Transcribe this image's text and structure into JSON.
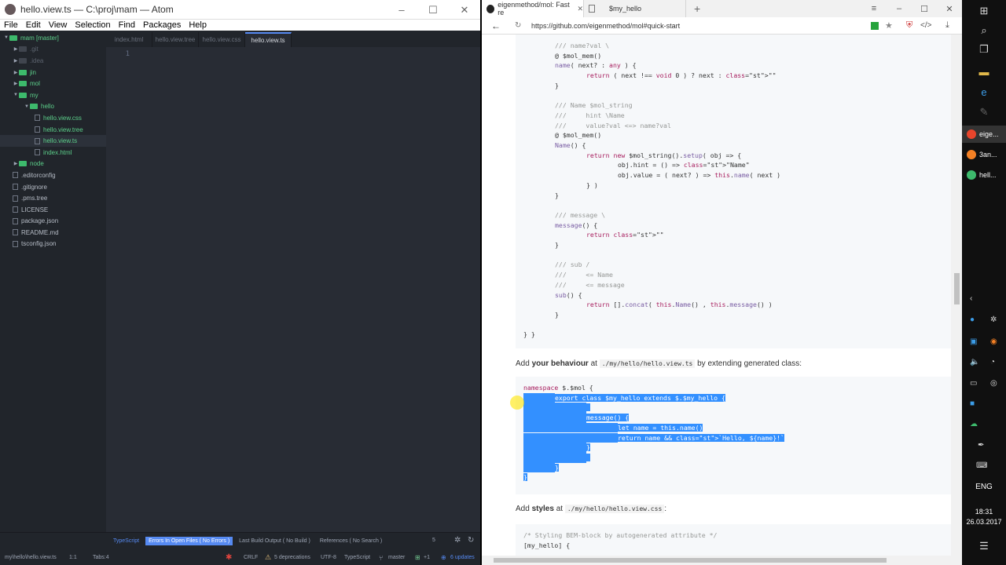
{
  "atom": {
    "title": "hello.view.ts — C:\\proj\\mam — Atom",
    "menu": [
      "File",
      "Edit",
      "View",
      "Selection",
      "Find",
      "Packages",
      "Help"
    ],
    "tree": [
      {
        "label": "mam [master]",
        "kind": "root"
      },
      {
        "label": ".git",
        "kind": "folder",
        "dim": true
      },
      {
        "label": ".idea",
        "kind": "folder",
        "dim": true
      },
      {
        "label": "jin",
        "kind": "folder"
      },
      {
        "label": "mol",
        "kind": "folder"
      },
      {
        "label": "my",
        "kind": "folder",
        "open": true
      },
      {
        "label": "hello",
        "kind": "folder",
        "open": true,
        "depth": 1
      },
      {
        "label": "hello.view.css",
        "kind": "file",
        "depth": 2
      },
      {
        "label": "hello.view.tree",
        "kind": "file",
        "depth": 2
      },
      {
        "label": "hello.view.ts",
        "kind": "file",
        "depth": 2,
        "selected": true
      },
      {
        "label": "index.html",
        "kind": "file",
        "depth": 2
      },
      {
        "label": "node",
        "kind": "folder"
      },
      {
        "label": ".editorconfig",
        "kind": "file"
      },
      {
        "label": ".gitignore",
        "kind": "file"
      },
      {
        "label": ".pms.tree",
        "kind": "file"
      },
      {
        "label": "LICENSE",
        "kind": "file"
      },
      {
        "label": "package.json",
        "kind": "file"
      },
      {
        "label": "README.md",
        "kind": "file"
      },
      {
        "label": "tsconfig.json",
        "kind": "file"
      }
    ],
    "tabs": [
      "index.html",
      "hello.view.tree",
      "hello.view.css",
      "hello.view.ts"
    ],
    "active_tab": 3,
    "line_number": "1",
    "ts_bar": {
      "typescript": "TypeScript",
      "errors": "Errors In Open Files ( No Errors )",
      "build": "Last Build Output ( No Build )",
      "refs": "References ( No Search )",
      "count": "5"
    },
    "status": {
      "path": "my\\hello\\hello.view.ts",
      "pos": "1:1",
      "tabs": "Tabs:4",
      "eol": "CRLF",
      "deprecations": "5 deprecations",
      "enc": "UTF-8",
      "grammar": "TypeScript",
      "branch": "master",
      "diff": "+1",
      "updates": "6 updates"
    }
  },
  "browser": {
    "tabs": [
      {
        "title": "eigenmethod/mol: Fast re"
      },
      {
        "title": "$my_hello"
      }
    ],
    "url": "https://github.com/eigenmethod/mol#quick-start",
    "code1": [
      {
        "t": "/// name?val \\",
        "c": "cm",
        "i": 1
      },
      {
        "t": "@ $mol_mem()",
        "c": "",
        "i": 1
      },
      {
        "t": "name( next? : any ) {",
        "c": "",
        "i": 1
      },
      {
        "t": "return ( next !== void 0 ) ? next : \"\"",
        "c": "",
        "i": 2
      },
      {
        "t": "}",
        "c": "",
        "i": 1
      },
      {
        "t": "",
        "c": "",
        "i": 0
      },
      {
        "t": "/// Name $mol_string",
        "c": "cm",
        "i": 1
      },
      {
        "t": "///     hint \\Name",
        "c": "cm",
        "i": 1
      },
      {
        "t": "///     value?val <=> name?val",
        "c": "cm",
        "i": 1
      },
      {
        "t": "@ $mol_mem()",
        "c": "",
        "i": 1
      },
      {
        "t": "Name() {",
        "c": "",
        "i": 1
      },
      {
        "t": "return new $mol_string().setup( obj => {",
        "c": "",
        "i": 2
      },
      {
        "t": "obj.hint = () => \"Name\"",
        "c": "",
        "i": 3
      },
      {
        "t": "obj.value = ( next? ) => this.name( next )",
        "c": "",
        "i": 3
      },
      {
        "t": "} )",
        "c": "",
        "i": 2
      },
      {
        "t": "}",
        "c": "",
        "i": 1
      },
      {
        "t": "",
        "c": "",
        "i": 0
      },
      {
        "t": "/// message \\",
        "c": "cm",
        "i": 1
      },
      {
        "t": "message() {",
        "c": "",
        "i": 1
      },
      {
        "t": "return \"\"",
        "c": "",
        "i": 2
      },
      {
        "t": "}",
        "c": "",
        "i": 1
      },
      {
        "t": "",
        "c": "",
        "i": 0
      },
      {
        "t": "/// sub /",
        "c": "cm",
        "i": 1
      },
      {
        "t": "///     <= Name",
        "c": "cm",
        "i": 1
      },
      {
        "t": "///     <= message",
        "c": "cm",
        "i": 1
      },
      {
        "t": "sub() {",
        "c": "",
        "i": 1
      },
      {
        "t": "return [].concat( this.Name() , this.message() )",
        "c": "",
        "i": 2
      },
      {
        "t": "}",
        "c": "",
        "i": 1
      },
      {
        "t": "",
        "c": "",
        "i": 0
      },
      {
        "t": "} }",
        "c": "",
        "i": 0
      }
    ],
    "para1": {
      "pre": "Add ",
      "bold": "your behaviour",
      "mid": " at ",
      "code": "./my/hello/hello.view.ts",
      "post": " by extending generated class:"
    },
    "code2": [
      {
        "t": "namespace $.$mol {",
        "i": 0,
        "hl": false
      },
      {
        "t": "export class $my_hello extends $.$my_hello {",
        "i": 1,
        "hl": true
      },
      {
        "t": "",
        "i": 2,
        "hl": true
      },
      {
        "t": "message() {",
        "i": 2,
        "hl": true
      },
      {
        "t": "let name = this.name()",
        "i": 3,
        "hl": true
      },
      {
        "t": "return name && `Hello, ${name}!`",
        "i": 3,
        "hl": true
      },
      {
        "t": "}",
        "i": 2,
        "hl": true
      },
      {
        "t": "",
        "i": 2,
        "hl": true
      },
      {
        "t": "}",
        "i": 1,
        "hl": true
      },
      {
        "t": "}",
        "i": 0,
        "hl": true
      }
    ],
    "para2": {
      "pre": "Add ",
      "bold": "styles",
      "mid": " at ",
      "code": "./my/hello/hello.view.css",
      "post": ":"
    },
    "code3": [
      {
        "t": "/* Styling BEM-block by autogenerated attribute */",
        "c": "cm",
        "i": 0
      },
      {
        "t": "[my_hello] {",
        "c": "",
        "i": 0
      }
    ]
  },
  "taskbar": {
    "apps": [
      {
        "label": "eige...",
        "color": "#e8452c",
        "active": true
      },
      {
        "label": "3an...",
        "color": "#f48024"
      },
      {
        "label": "hell...",
        "color": "#3dba6c"
      }
    ],
    "lang": "ENG",
    "time": "18:31",
    "date": "26.03.2017"
  }
}
